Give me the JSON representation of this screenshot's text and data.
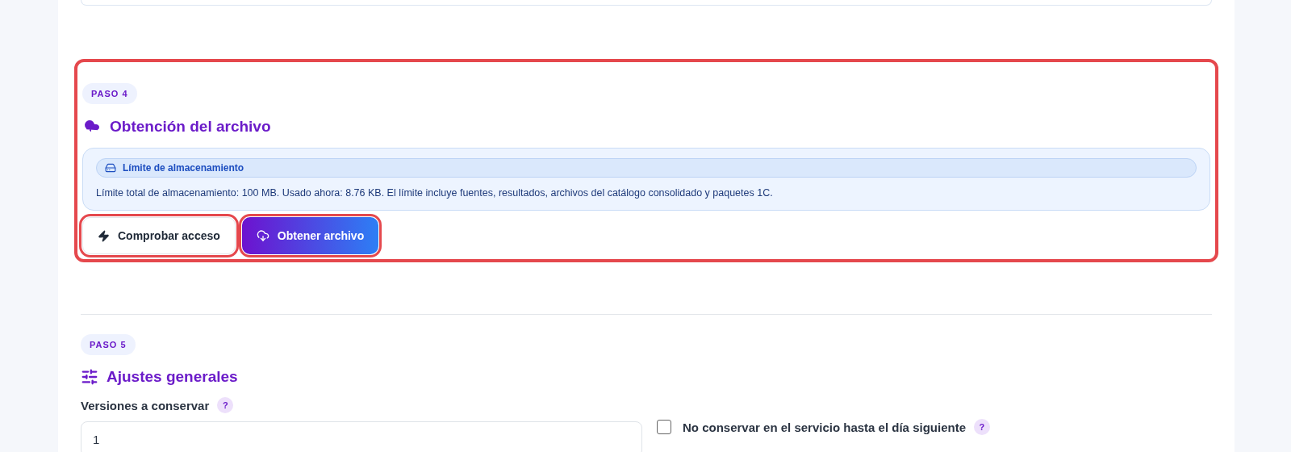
{
  "step4": {
    "badge": "PASO 4",
    "title": "Obtención del archivo",
    "highlighted": true,
    "info": {
      "label": "Límite de almacenamiento",
      "text": "Límite total de almacenamiento: 100 MB. Usado ahora: 8.76 KB. El límite incluye fuentes, resultados, archivos del catálogo consolidado y paquetes 1C."
    },
    "buttons": [
      {
        "label": "Comprobar acceso",
        "kind": "secondary",
        "highlighted": true
      },
      {
        "label": "Obtener archivo",
        "kind": "primary",
        "highlighted": true
      }
    ]
  },
  "step5": {
    "badge": "PASO 5",
    "title": "Ajustes generales",
    "versions": {
      "label": "Versiones a conservar",
      "help": "?",
      "value": "1"
    },
    "no_keep": {
      "label": "No conservar en el servicio hasta el día siguiente",
      "help": "?",
      "checked": false
    }
  }
}
